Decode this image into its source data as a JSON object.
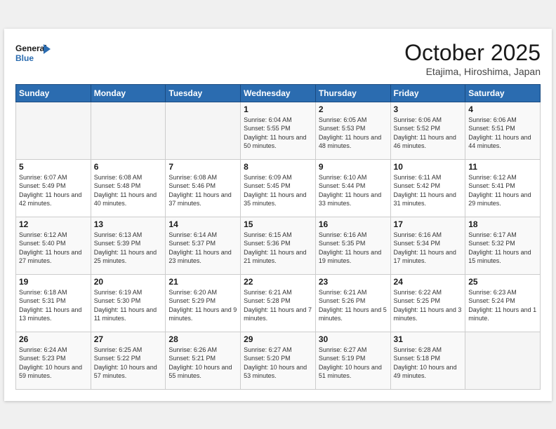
{
  "header": {
    "logo_line1": "General",
    "logo_line2": "Blue",
    "month": "October 2025",
    "location": "Etajima, Hiroshima, Japan"
  },
  "weekdays": [
    "Sunday",
    "Monday",
    "Tuesday",
    "Wednesday",
    "Thursday",
    "Friday",
    "Saturday"
  ],
  "weeks": [
    [
      {
        "day": "",
        "sunrise": "",
        "sunset": "",
        "daylight": ""
      },
      {
        "day": "",
        "sunrise": "",
        "sunset": "",
        "daylight": ""
      },
      {
        "day": "",
        "sunrise": "",
        "sunset": "",
        "daylight": ""
      },
      {
        "day": "1",
        "sunrise": "Sunrise: 6:04 AM",
        "sunset": "Sunset: 5:55 PM",
        "daylight": "Daylight: 11 hours and 50 minutes."
      },
      {
        "day": "2",
        "sunrise": "Sunrise: 6:05 AM",
        "sunset": "Sunset: 5:53 PM",
        "daylight": "Daylight: 11 hours and 48 minutes."
      },
      {
        "day": "3",
        "sunrise": "Sunrise: 6:06 AM",
        "sunset": "Sunset: 5:52 PM",
        "daylight": "Daylight: 11 hours and 46 minutes."
      },
      {
        "day": "4",
        "sunrise": "Sunrise: 6:06 AM",
        "sunset": "Sunset: 5:51 PM",
        "daylight": "Daylight: 11 hours and 44 minutes."
      }
    ],
    [
      {
        "day": "5",
        "sunrise": "Sunrise: 6:07 AM",
        "sunset": "Sunset: 5:49 PM",
        "daylight": "Daylight: 11 hours and 42 minutes."
      },
      {
        "day": "6",
        "sunrise": "Sunrise: 6:08 AM",
        "sunset": "Sunset: 5:48 PM",
        "daylight": "Daylight: 11 hours and 40 minutes."
      },
      {
        "day": "7",
        "sunrise": "Sunrise: 6:08 AM",
        "sunset": "Sunset: 5:46 PM",
        "daylight": "Daylight: 11 hours and 37 minutes."
      },
      {
        "day": "8",
        "sunrise": "Sunrise: 6:09 AM",
        "sunset": "Sunset: 5:45 PM",
        "daylight": "Daylight: 11 hours and 35 minutes."
      },
      {
        "day": "9",
        "sunrise": "Sunrise: 6:10 AM",
        "sunset": "Sunset: 5:44 PM",
        "daylight": "Daylight: 11 hours and 33 minutes."
      },
      {
        "day": "10",
        "sunrise": "Sunrise: 6:11 AM",
        "sunset": "Sunset: 5:42 PM",
        "daylight": "Daylight: 11 hours and 31 minutes."
      },
      {
        "day": "11",
        "sunrise": "Sunrise: 6:12 AM",
        "sunset": "Sunset: 5:41 PM",
        "daylight": "Daylight: 11 hours and 29 minutes."
      }
    ],
    [
      {
        "day": "12",
        "sunrise": "Sunrise: 6:12 AM",
        "sunset": "Sunset: 5:40 PM",
        "daylight": "Daylight: 11 hours and 27 minutes."
      },
      {
        "day": "13",
        "sunrise": "Sunrise: 6:13 AM",
        "sunset": "Sunset: 5:39 PM",
        "daylight": "Daylight: 11 hours and 25 minutes."
      },
      {
        "day": "14",
        "sunrise": "Sunrise: 6:14 AM",
        "sunset": "Sunset: 5:37 PM",
        "daylight": "Daylight: 11 hours and 23 minutes."
      },
      {
        "day": "15",
        "sunrise": "Sunrise: 6:15 AM",
        "sunset": "Sunset: 5:36 PM",
        "daylight": "Daylight: 11 hours and 21 minutes."
      },
      {
        "day": "16",
        "sunrise": "Sunrise: 6:16 AM",
        "sunset": "Sunset: 5:35 PM",
        "daylight": "Daylight: 11 hours and 19 minutes."
      },
      {
        "day": "17",
        "sunrise": "Sunrise: 6:16 AM",
        "sunset": "Sunset: 5:34 PM",
        "daylight": "Daylight: 11 hours and 17 minutes."
      },
      {
        "day": "18",
        "sunrise": "Sunrise: 6:17 AM",
        "sunset": "Sunset: 5:32 PM",
        "daylight": "Daylight: 11 hours and 15 minutes."
      }
    ],
    [
      {
        "day": "19",
        "sunrise": "Sunrise: 6:18 AM",
        "sunset": "Sunset: 5:31 PM",
        "daylight": "Daylight: 11 hours and 13 minutes."
      },
      {
        "day": "20",
        "sunrise": "Sunrise: 6:19 AM",
        "sunset": "Sunset: 5:30 PM",
        "daylight": "Daylight: 11 hours and 11 minutes."
      },
      {
        "day": "21",
        "sunrise": "Sunrise: 6:20 AM",
        "sunset": "Sunset: 5:29 PM",
        "daylight": "Daylight: 11 hours and 9 minutes."
      },
      {
        "day": "22",
        "sunrise": "Sunrise: 6:21 AM",
        "sunset": "Sunset: 5:28 PM",
        "daylight": "Daylight: 11 hours and 7 minutes."
      },
      {
        "day": "23",
        "sunrise": "Sunrise: 6:21 AM",
        "sunset": "Sunset: 5:26 PM",
        "daylight": "Daylight: 11 hours and 5 minutes."
      },
      {
        "day": "24",
        "sunrise": "Sunrise: 6:22 AM",
        "sunset": "Sunset: 5:25 PM",
        "daylight": "Daylight: 11 hours and 3 minutes."
      },
      {
        "day": "25",
        "sunrise": "Sunrise: 6:23 AM",
        "sunset": "Sunset: 5:24 PM",
        "daylight": "Daylight: 11 hours and 1 minute."
      }
    ],
    [
      {
        "day": "26",
        "sunrise": "Sunrise: 6:24 AM",
        "sunset": "Sunset: 5:23 PM",
        "daylight": "Daylight: 10 hours and 59 minutes."
      },
      {
        "day": "27",
        "sunrise": "Sunrise: 6:25 AM",
        "sunset": "Sunset: 5:22 PM",
        "daylight": "Daylight: 10 hours and 57 minutes."
      },
      {
        "day": "28",
        "sunrise": "Sunrise: 6:26 AM",
        "sunset": "Sunset: 5:21 PM",
        "daylight": "Daylight: 10 hours and 55 minutes."
      },
      {
        "day": "29",
        "sunrise": "Sunrise: 6:27 AM",
        "sunset": "Sunset: 5:20 PM",
        "daylight": "Daylight: 10 hours and 53 minutes."
      },
      {
        "day": "30",
        "sunrise": "Sunrise: 6:27 AM",
        "sunset": "Sunset: 5:19 PM",
        "daylight": "Daylight: 10 hours and 51 minutes."
      },
      {
        "day": "31",
        "sunrise": "Sunrise: 6:28 AM",
        "sunset": "Sunset: 5:18 PM",
        "daylight": "Daylight: 10 hours and 49 minutes."
      },
      {
        "day": "",
        "sunrise": "",
        "sunset": "",
        "daylight": ""
      }
    ]
  ]
}
